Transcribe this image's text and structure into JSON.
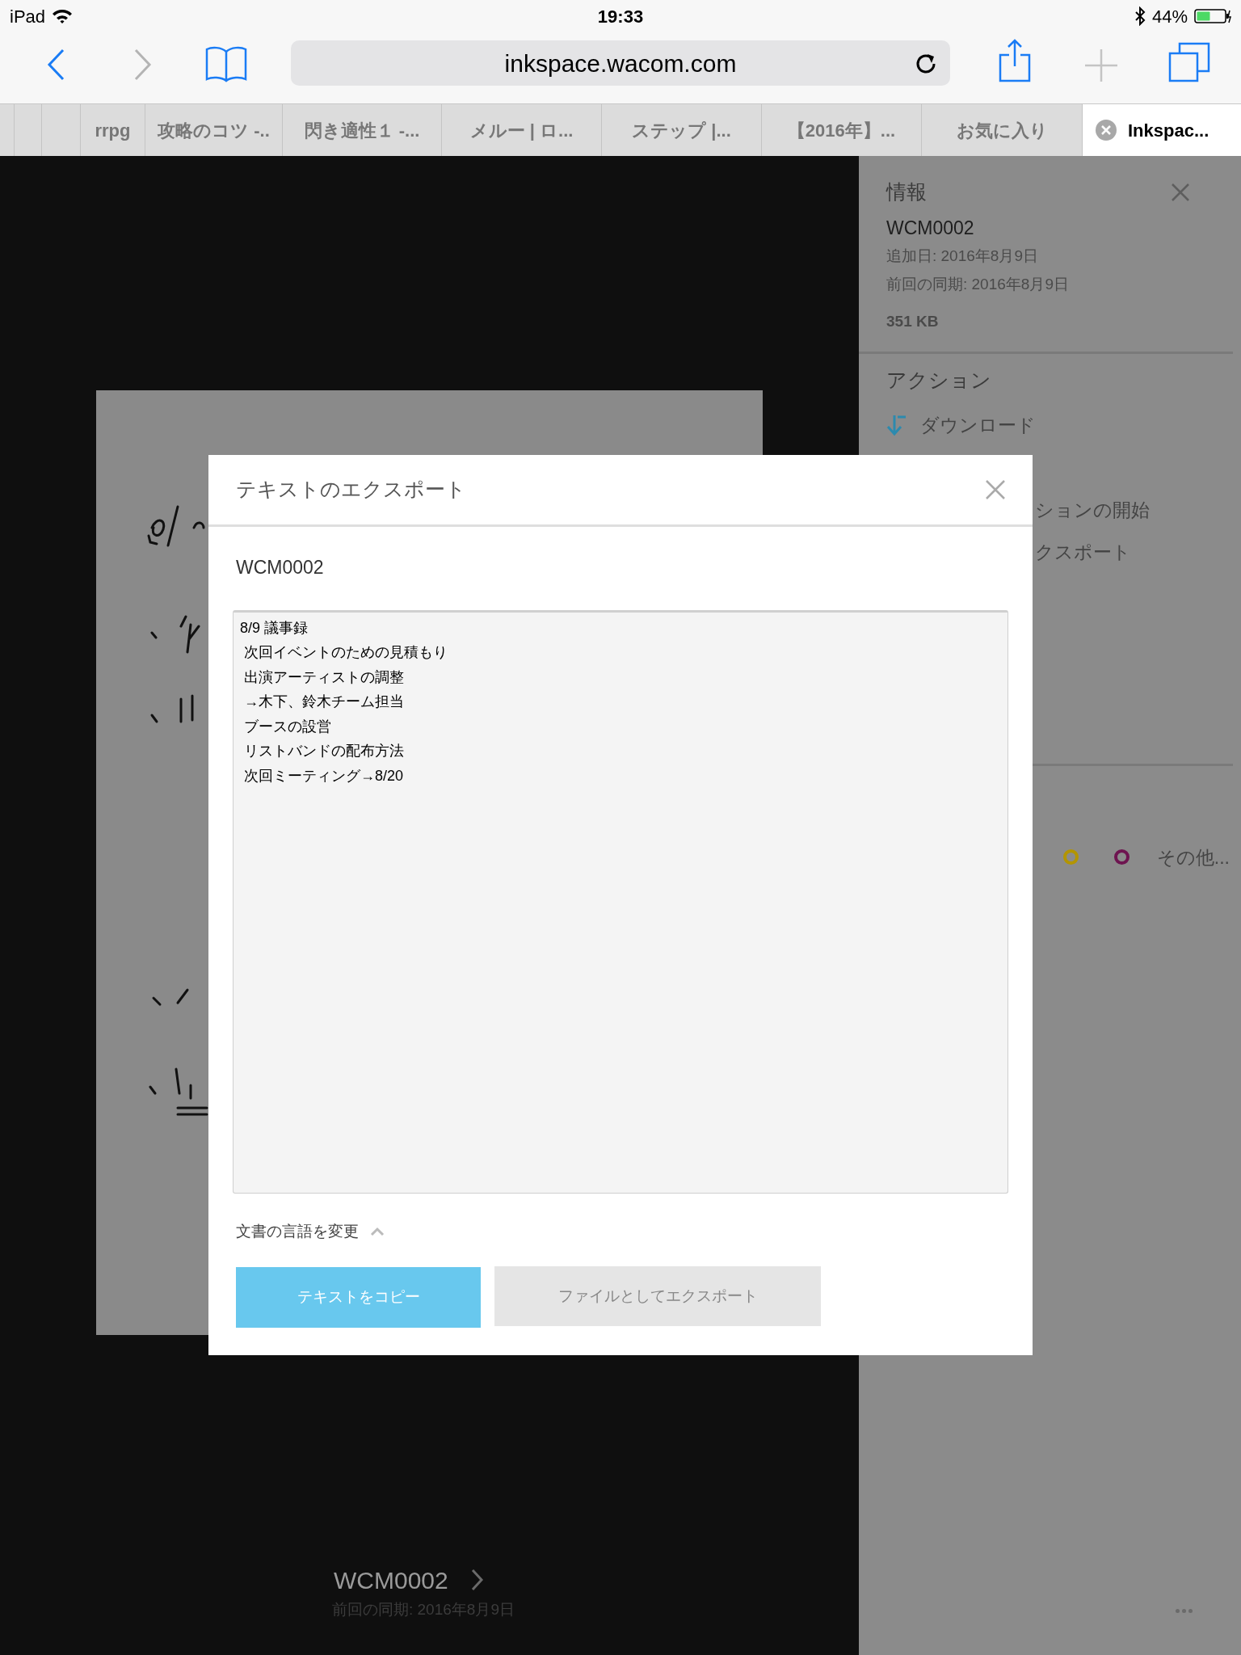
{
  "status_bar": {
    "carrier": "iPad",
    "time": "19:33",
    "battery": "44%"
  },
  "toolbar": {
    "url": "inkspace.wacom.com"
  },
  "tabs": [
    {
      "label": "rrpg",
      "selected": false
    },
    {
      "label": "攻略のコツ -..",
      "selected": false
    },
    {
      "label": "閃き適性１ -...",
      "selected": false
    },
    {
      "label": "メルー | ロ...",
      "selected": false
    },
    {
      "label": "ステップ |...",
      "selected": false
    },
    {
      "label": "【2016年】...",
      "selected": false
    },
    {
      "label": "お気に入り",
      "selected": false
    },
    {
      "label": "Inkspac...",
      "selected": true
    }
  ],
  "viewer": {
    "document_title": "WCM0002",
    "last_sync": "前回の同期: 2016年8月9日"
  },
  "info_panel": {
    "title": "情報",
    "document_name": "WCM0002",
    "added": "追加日: 2016年8月9日",
    "last_sync": "前回の同期: 2016年8月9日",
    "size": "351 KB",
    "actions_title": "アクション",
    "actions": [
      {
        "label": "ダウンロード",
        "kind": "download"
      },
      {
        "label": "ションの開始",
        "kind": "partial"
      },
      {
        "label": "クスポート",
        "kind": "partial"
      }
    ],
    "tags": [
      {
        "color": "#b39500"
      },
      {
        "color": "#6e1450"
      }
    ],
    "more_tags": "その他..."
  },
  "dialog": {
    "title": "テキストのエクスポート",
    "document_name": "WCM0002",
    "text_lines": [
      "8/9 議事録",
      " 次回イベントのための見積もり",
      " 出演アーティストの調整",
      " →木下、鈴木チーム担当",
      " ブースの設営",
      " リストバンドの配布方法",
      " 次回ミーティング→8/20"
    ],
    "language_toggle": {
      "label": "文書の言語を変更",
      "expanded": true
    },
    "buttons": [
      {
        "label": "テキストをコピー",
        "kind": "primary"
      },
      {
        "label": "ファイルとしてエクスポート",
        "kind": "secondary"
      }
    ]
  }
}
